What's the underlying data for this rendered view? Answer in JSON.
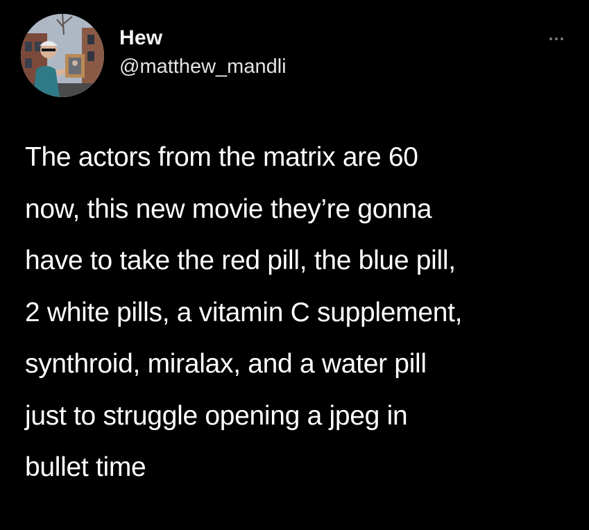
{
  "tweet": {
    "author": {
      "display_name": "Hew",
      "handle": "@matthew_mandli",
      "avatar_icon": "profile-photo"
    },
    "more_icon": "ellipsis-icon",
    "text_lines": [
      "The actors from the matrix are 60",
      "now, this new movie they’re gonna",
      "have to take the red pill, the blue pill,",
      "2 white pills, a vitamin C supplement,",
      "synthroid, miralax, and a water pill",
      "just to struggle opening a jpeg in",
      "bullet time"
    ]
  },
  "colors": {
    "background": "#000000",
    "text": "#ffffff",
    "secondary_text": "#e4e4e4",
    "icon": "#7a7a7a"
  }
}
